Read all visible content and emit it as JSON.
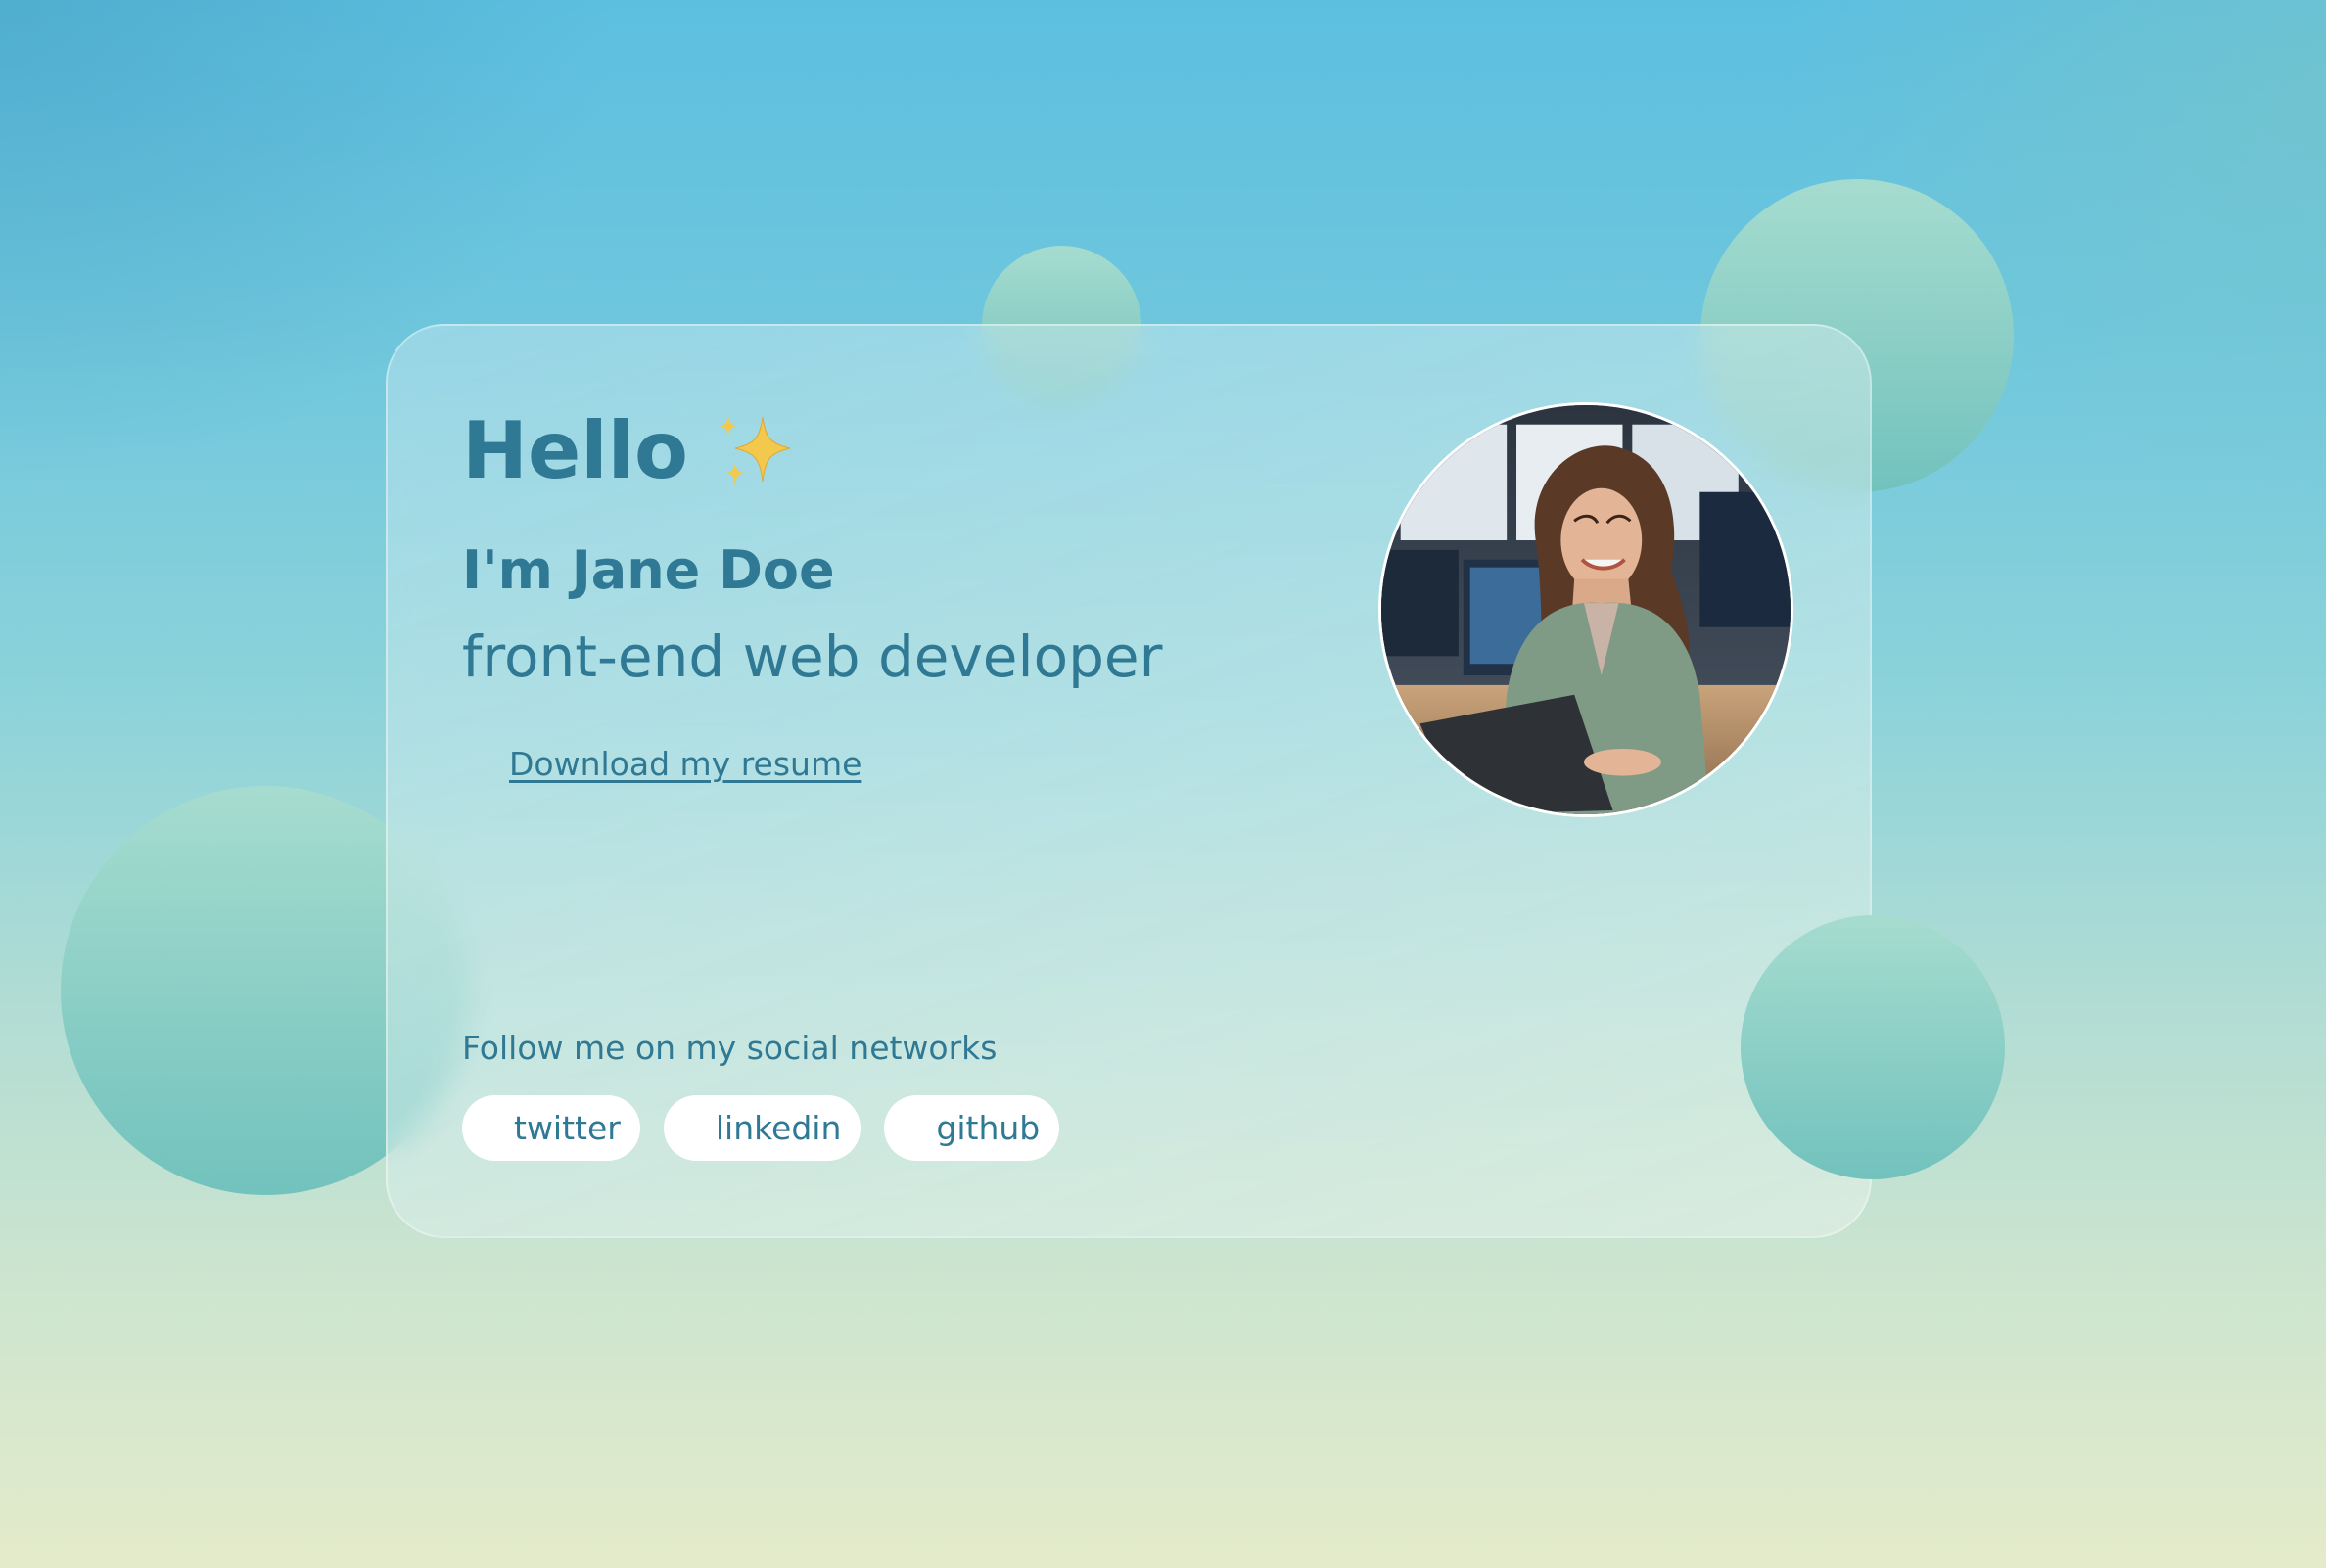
{
  "hero": {
    "greeting": "Hello",
    "greeting_icon": "sparkles-icon",
    "name": "I'm Jane Doe",
    "role": "front-end web developer",
    "resume_link": "Download my resume"
  },
  "avatar": {
    "description_icon": "profile-photo"
  },
  "social": {
    "heading": "Follow me on my social networks",
    "links": [
      {
        "label": "twitter"
      },
      {
        "label": "linkedin"
      },
      {
        "label": "github"
      }
    ]
  },
  "colors": {
    "text": "#2f7994",
    "bubble": "#72c2bd",
    "pill_bg": "#ffffff",
    "sparkle": "#f2c94c"
  }
}
